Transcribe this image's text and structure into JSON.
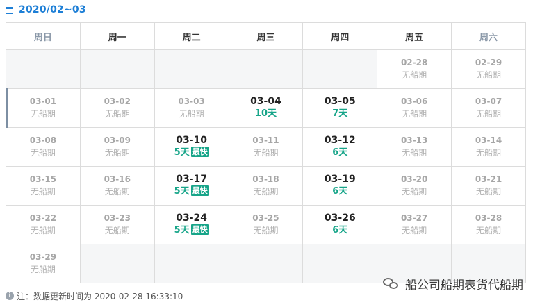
{
  "header": {
    "title": "2020/02~03",
    "icon": "calendar-icon"
  },
  "weekdays": [
    "周日",
    "周一",
    "周二",
    "周三",
    "周四",
    "周五",
    "周六"
  ],
  "weeks": [
    [
      {
        "date": "",
        "status": ""
      },
      {
        "date": "",
        "status": ""
      },
      {
        "date": "",
        "status": ""
      },
      {
        "date": "",
        "status": ""
      },
      {
        "date": "",
        "status": ""
      },
      {
        "date": "02-28",
        "status": "无船期"
      },
      {
        "date": "02-29",
        "status": "无船期"
      }
    ],
    [
      {
        "date": "03-01",
        "status": "无船期",
        "today": true
      },
      {
        "date": "03-02",
        "status": "无船期"
      },
      {
        "date": "03-03",
        "status": "无船期"
      },
      {
        "date": "03-04",
        "status": "10天",
        "active": true
      },
      {
        "date": "03-05",
        "status": "7天",
        "active": true
      },
      {
        "date": "03-06",
        "status": "无船期"
      },
      {
        "date": "03-07",
        "status": "无船期"
      }
    ],
    [
      {
        "date": "03-08",
        "status": "无船期"
      },
      {
        "date": "03-09",
        "status": "无船期"
      },
      {
        "date": "03-10",
        "status": "5天",
        "active": true,
        "badge": "最快"
      },
      {
        "date": "03-11",
        "status": "无船期"
      },
      {
        "date": "03-12",
        "status": "6天",
        "active": true
      },
      {
        "date": "03-13",
        "status": "无船期"
      },
      {
        "date": "03-14",
        "status": "无船期"
      }
    ],
    [
      {
        "date": "03-15",
        "status": "无船期"
      },
      {
        "date": "03-16",
        "status": "无船期"
      },
      {
        "date": "03-17",
        "status": "5天",
        "active": true,
        "badge": "最快"
      },
      {
        "date": "03-18",
        "status": "无船期"
      },
      {
        "date": "03-19",
        "status": "6天",
        "active": true
      },
      {
        "date": "03-20",
        "status": "无船期"
      },
      {
        "date": "03-21",
        "status": "无船期"
      }
    ],
    [
      {
        "date": "03-22",
        "status": "无船期"
      },
      {
        "date": "03-23",
        "status": "无船期"
      },
      {
        "date": "03-24",
        "status": "5天",
        "active": true,
        "badge": "最快"
      },
      {
        "date": "03-25",
        "status": "无船期"
      },
      {
        "date": "03-26",
        "status": "6天",
        "active": true
      },
      {
        "date": "03-27",
        "status": "无船期"
      },
      {
        "date": "03-28",
        "status": "无船期"
      }
    ],
    [
      {
        "date": "03-29",
        "status": "无船期"
      },
      {
        "date": "",
        "status": ""
      },
      {
        "date": "",
        "status": ""
      },
      {
        "date": "",
        "status": ""
      },
      {
        "date": "",
        "status": ""
      },
      {
        "date": "",
        "status": ""
      },
      {
        "date": "",
        "status": ""
      }
    ]
  ],
  "footer": {
    "note_prefix": "注：",
    "text": "数据更新时间为 2020-02-28 16:33:10"
  },
  "watermark": {
    "text": "船公司船期表货代船期",
    "icon": "wechat-icon"
  },
  "colors": {
    "accent": "#1e7fd6",
    "available": "#17a589",
    "muted": "#a6a6a6",
    "today_bar": "#7d8fa3"
  }
}
